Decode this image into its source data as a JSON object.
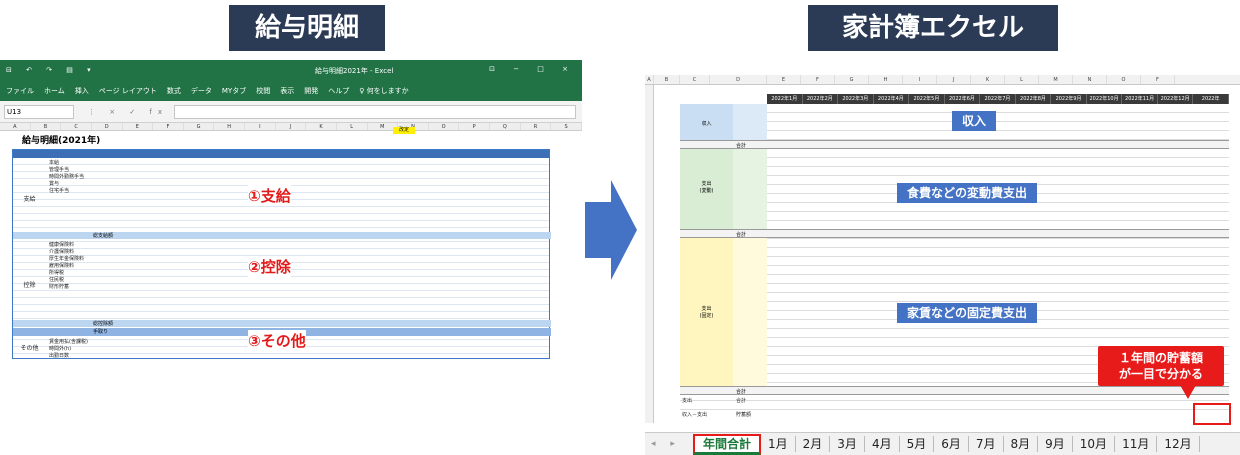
{
  "left_badge": "給与明細",
  "right_badge": "家計簿エクセル",
  "left_excel": {
    "quick_access": "⊟ ↶ ↷ ▤ ▾",
    "window_title": "給与明細2021年 - Excel",
    "window_controls": "⊡ − □ ×",
    "menu": [
      "ファイル",
      "ホーム",
      "挿入",
      "ページ レイアウト",
      "数式",
      "データ",
      "MYタブ",
      "校閲",
      "表示",
      "開発",
      "ヘルプ",
      "♀ 何をしますか"
    ],
    "name_box": "U13",
    "fx_icons": "⋮ × ✓ fx",
    "col_letters": [
      "A",
      "B",
      "C",
      "D",
      "E",
      "F",
      "G",
      "H",
      "I",
      "J",
      "K",
      "L",
      "M",
      "N",
      "O",
      "P",
      "Q",
      "R",
      "S"
    ],
    "sheet_title": "給与明細(2021年)",
    "kaisei": "改定",
    "sections": {
      "shikyu": "支給",
      "kojo": "控除",
      "sonota": "その他"
    },
    "totals": {
      "shikyu_total": "総支給額",
      "kojo_total": "総控除額",
      "tedori": "手取り"
    },
    "row_labels": [
      "本給",
      "管理手当",
      "時間外勤務手当",
      "賞与",
      "住宅手当",
      "健康保険料",
      "介護保険料",
      "厚生年金保険料",
      "雇用保険料",
      "所得税",
      "住民税",
      "財形貯蓄",
      "賃金用払(含課税)",
      "時間外(h)",
      "出勤日数"
    ],
    "annotations": {
      "a1": "①支給",
      "a2": "②控除",
      "a3": "③その他"
    }
  },
  "right_excel": {
    "col_letters": [
      "A",
      "B",
      "C",
      "D",
      "E",
      "F",
      "G",
      "H",
      "I",
      "J",
      "K",
      "L",
      "M",
      "N",
      "O",
      "F"
    ],
    "months": [
      "2022年1月",
      "2022年2月",
      "2022年3月",
      "2022年4月",
      "2022年5月",
      "2022年6月",
      "2022年7月",
      "2022年8月",
      "2022年9月",
      "2022年10月",
      "2022年11月",
      "2022年12月",
      "2022年"
    ],
    "groups": {
      "income": "収入",
      "variable": "支出\n(変動)",
      "fixed": "支出\n(固定)"
    },
    "sum_label": "合計",
    "rows_bottom": {
      "shishutsu": "支出",
      "shushi": "収入－支出",
      "chochiku": "貯蓄額"
    },
    "callouts": {
      "income": "収入",
      "variable": "食費などの変動費支出",
      "fixed": "家賃などの固定費支出",
      "savings": "１年間の貯蓄額\nが一目で分かる"
    },
    "tab_nav": "◂ ▸",
    "tabs": [
      "年間合計",
      "1月",
      "2月",
      "3月",
      "4月",
      "5月",
      "6月",
      "7月",
      "8月",
      "9月",
      "10月",
      "11月",
      "12月"
    ]
  },
  "colors": {
    "excel_green": "#217346",
    "badge": "#2b3a55",
    "arrow": "#4472c4",
    "red": "#e81b1b"
  }
}
